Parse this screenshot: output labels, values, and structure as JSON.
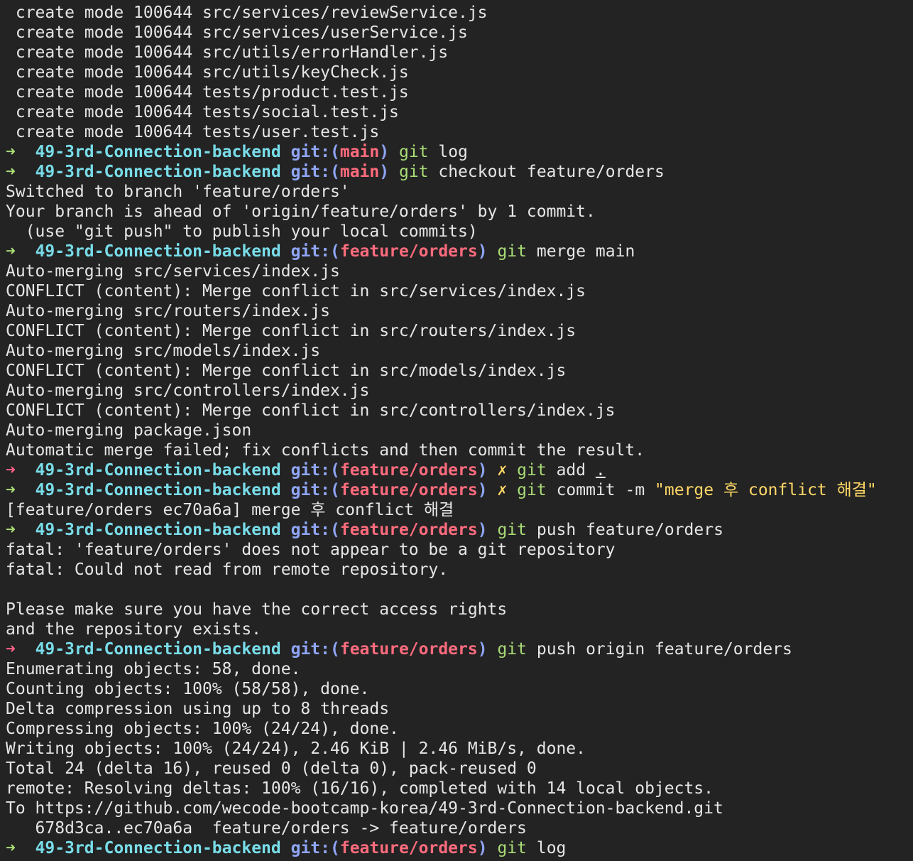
{
  "prompt": {
    "arrow": "➜",
    "dir": "49-3rd-Connection-backend",
    "git_open": "git:(",
    "git_close": ")",
    "dirty_mark": "✗"
  },
  "pre_output": [
    " create mode 100644 src/services/reviewService.js",
    " create mode 100644 src/services/userService.js",
    " create mode 100644 src/utils/errorHandler.js",
    " create mode 100644 src/utils/keyCheck.js",
    " create mode 100644 tests/product.test.js",
    " create mode 100644 tests/social.test.js",
    " create mode 100644 tests/user.test.js"
  ],
  "cmd1": {
    "branch": "main",
    "git": "git",
    "rest": " log"
  },
  "cmd2": {
    "branch": "main",
    "git": "git",
    "rest": " checkout feature/orders"
  },
  "out2": [
    "Switched to branch 'feature/orders'",
    "Your branch is ahead of 'origin/feature/orders' by 1 commit.",
    "  (use \"git push\" to publish your local commits)"
  ],
  "cmd3": {
    "branch": "feature/orders",
    "git": "git",
    "rest": " merge main"
  },
  "out3": [
    "Auto-merging src/services/index.js",
    "CONFLICT (content): Merge conflict in src/services/index.js",
    "Auto-merging src/routers/index.js",
    "CONFLICT (content): Merge conflict in src/routers/index.js",
    "Auto-merging src/models/index.js",
    "CONFLICT (content): Merge conflict in src/models/index.js",
    "Auto-merging src/controllers/index.js",
    "CONFLICT (content): Merge conflict in src/controllers/index.js",
    "Auto-merging package.json",
    "Automatic merge failed; fix conflicts and then commit the result."
  ],
  "cmd4": {
    "branch": "feature/orders",
    "git": "git",
    "rest": " add ",
    "dot": "."
  },
  "cmd5": {
    "branch": "feature/orders",
    "git": "git",
    "rest": " commit -m ",
    "msg": "\"merge 후 conflict 해결\""
  },
  "out5": "[feature/orders ec70a6a] merge 후 conflict 해결",
  "cmd6": {
    "branch": "feature/orders",
    "git": "git",
    "rest": " push feature/orders"
  },
  "out6": [
    "fatal: 'feature/orders' does not appear to be a git repository",
    "fatal: Could not read from remote repository.",
    "",
    "Please make sure you have the correct access rights",
    "and the repository exists."
  ],
  "cmd7": {
    "branch": "feature/orders",
    "git": "git",
    "rest": " push origin feature/orders"
  },
  "out7": [
    "Enumerating objects: 58, done.",
    "Counting objects: 100% (58/58), done.",
    "Delta compression using up to 8 threads",
    "Compressing objects: 100% (24/24), done.",
    "Writing objects: 100% (24/24), 2.46 KiB | 2.46 MiB/s, done.",
    "Total 24 (delta 16), reused 0 (delta 0), pack-reused 0",
    "remote: Resolving deltas: 100% (16/16), completed with 14 local objects.",
    "To https://github.com/wecode-bootcamp-korea/49-3rd-Connection-backend.git",
    "   678d3ca..ec70a6a  feature/orders -> feature/orders"
  ],
  "cmd8": {
    "branch": "feature/orders",
    "git": "git",
    "rest": " log"
  }
}
